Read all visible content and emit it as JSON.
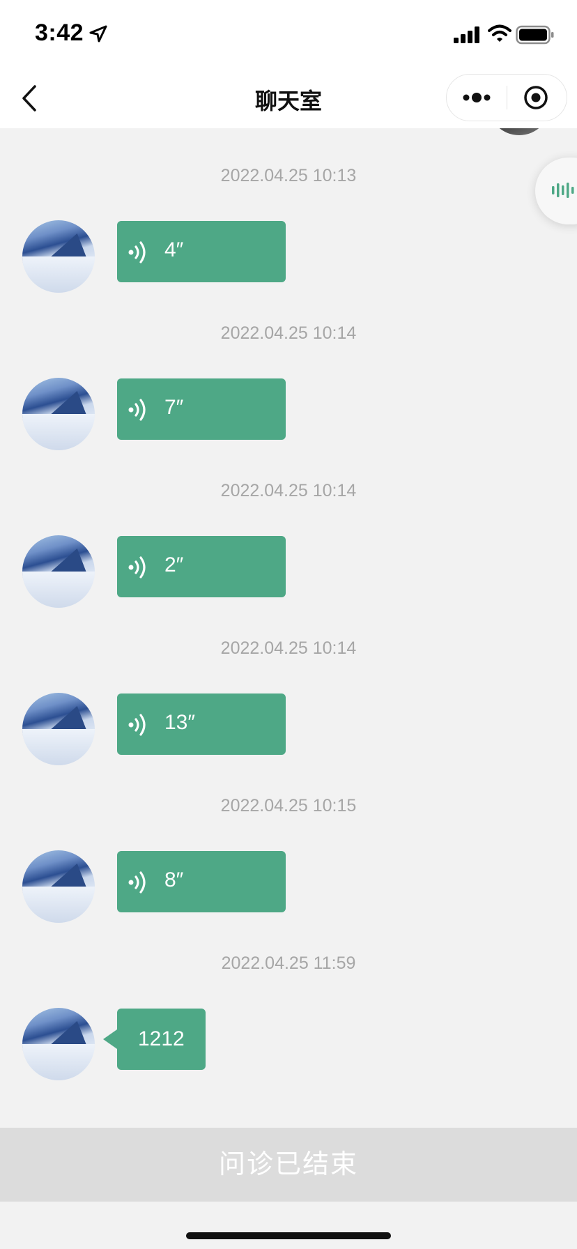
{
  "status_bar": {
    "time": "3:42"
  },
  "nav": {
    "title": "聊天室"
  },
  "messages": [
    {
      "timestamp": "2022.04.25 10:13",
      "type": "voice",
      "duration": "4″"
    },
    {
      "timestamp": "2022.04.25 10:14",
      "type": "voice",
      "duration": "7″"
    },
    {
      "timestamp": "2022.04.25 10:14",
      "type": "voice",
      "duration": "2″"
    },
    {
      "timestamp": "2022.04.25 10:14",
      "type": "voice",
      "duration": "13″"
    },
    {
      "timestamp": "2022.04.25 10:15",
      "type": "voice",
      "duration": "8″"
    },
    {
      "timestamp": "2022.04.25 11:59",
      "type": "text",
      "text": "1212"
    }
  ],
  "footer": {
    "status": "问诊已结束"
  },
  "colors": {
    "bubble": "#4ea886",
    "background": "#f2f2f2",
    "ended_bar": "#dcdcdc",
    "timestamp": "#a6a6a6"
  },
  "icons": {
    "back": "chevron-left-icon",
    "more": "more-dots-icon",
    "close": "target-circle-icon",
    "voice": "voice-wave-icon",
    "floating": "audio-bars-icon"
  }
}
